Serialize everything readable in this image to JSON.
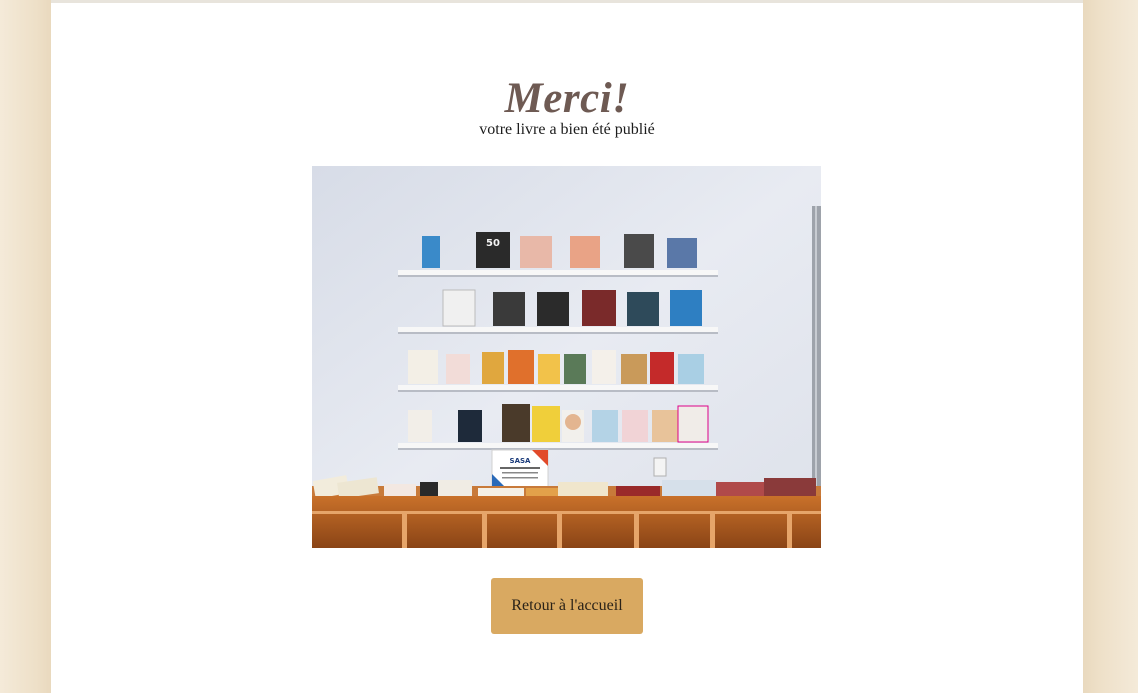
{
  "confirmation": {
    "title": "Merci!",
    "subtitle": "votre livre a bien été publié"
  },
  "photo": {
    "subject": "bookshelf-display",
    "sign_text": [
      "SASA",
      "조사해야 가능",
      "기업은 10000원",
      "기업은 20000원"
    ]
  },
  "actions": {
    "home_button_label": "Retour à l'accueil"
  },
  "colors": {
    "title": "#6e5a53",
    "button": "#d9a961",
    "side_background": "#f0e4d0",
    "panel_background": "#ffffff"
  }
}
